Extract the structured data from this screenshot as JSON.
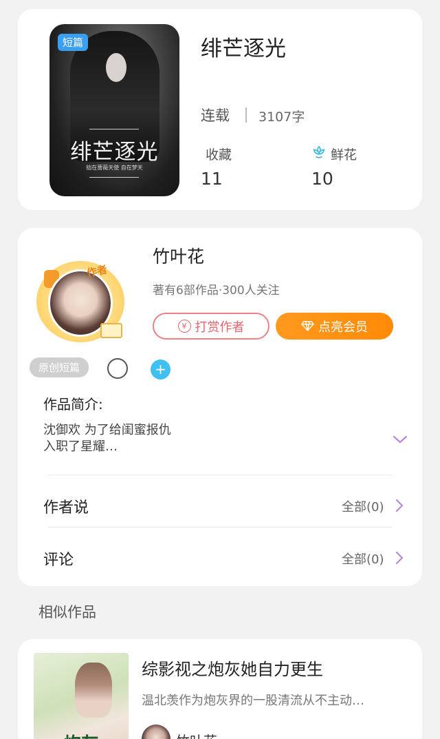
{
  "book": {
    "badge": "短篇",
    "cover_title": "绯芒逐光",
    "cover_subtitle": "拙在蔷薇天使 自在梦天",
    "title": "绯芒逐光",
    "status": "连载",
    "word_count": "3107字",
    "favorites_label": "收藏",
    "favorites_value": "11",
    "flowers_label": "鲜花",
    "flowers_value": "10"
  },
  "author": {
    "tag": "作者",
    "name": "竹叶花",
    "meta": "著有6部作品·300人关注",
    "tip_button": "打赏作者",
    "tip_icon_char": "¥",
    "vip_button": "点亮会员",
    "category_tag": "原创短篇",
    "plus_char": "+"
  },
  "intro": {
    "label": "作品简介:",
    "text_line1": "沈御欢 为了给闺蜜报仇",
    "text_line2": "入职了星耀…"
  },
  "rows": {
    "author_says": "作者说",
    "author_says_more": "全部(0)",
    "comments": "评论",
    "comments_more": "全部(0)"
  },
  "similar": {
    "section_title": "相似作品",
    "cover_text": "炮灰",
    "title": "综影视之炮灰她自力更生",
    "desc": "温北羡作为炮灰界的一股清流从不主动…",
    "author": "竹叶花"
  },
  "colors": {
    "accent_orange": "#ff9a1f",
    "tip_red": "#e8636b",
    "plus_blue": "#3fc0f0",
    "badge_blue": "#3b9ff0",
    "chevron_purple": "#b48ad8"
  },
  "icons": [
    "flower-icon",
    "yen-icon",
    "diamond-icon",
    "plus-icon",
    "chevron-down-icon",
    "chevron-right-icon"
  ]
}
